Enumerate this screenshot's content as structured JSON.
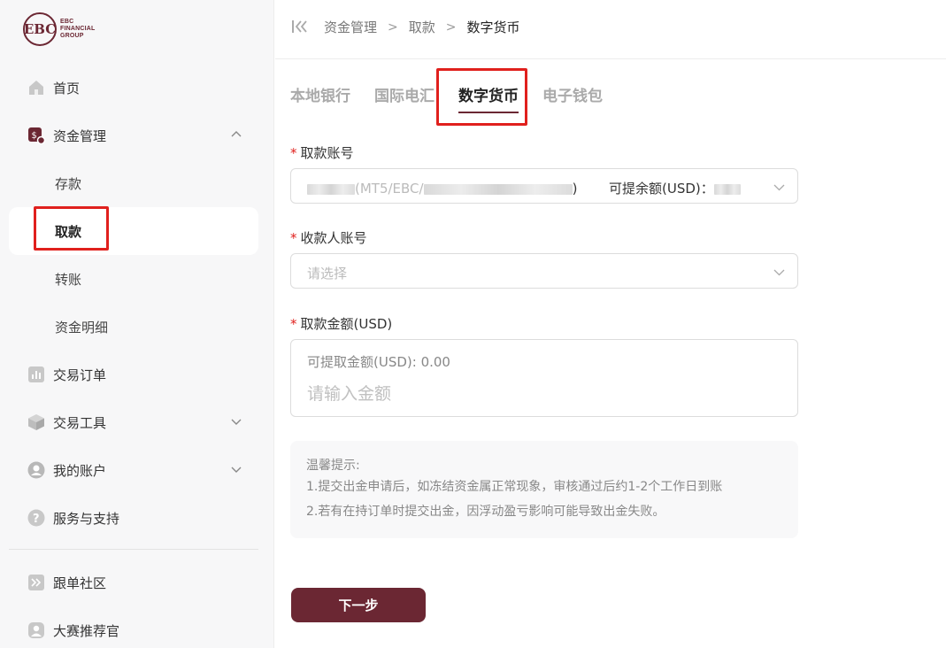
{
  "brand": {
    "logo_letters": "EBC",
    "line1": "EBC",
    "line2": "FINANCIAL",
    "line3": "GROUP",
    "color": "#6b2733"
  },
  "sidebar": {
    "items": [
      {
        "label": "首页",
        "icon": "home-icon"
      },
      {
        "label": "资金管理",
        "icon": "fund-icon",
        "expanded": true
      },
      {
        "label": "交易订单",
        "icon": "chart-icon"
      },
      {
        "label": "交易工具",
        "icon": "cube-icon"
      },
      {
        "label": "我的账户",
        "icon": "user-icon"
      },
      {
        "label": "服务与支持",
        "icon": "help-icon"
      },
      {
        "label": "跟单社区",
        "icon": "copy-trade-icon"
      },
      {
        "label": "大赛推荐官",
        "icon": "referral-icon"
      }
    ],
    "sub_items": [
      {
        "label": "存款"
      },
      {
        "label": "取款",
        "active": true
      },
      {
        "label": "转账"
      },
      {
        "label": "资金明细"
      }
    ]
  },
  "breadcrumb": {
    "items": [
      "资金管理",
      "取款",
      "数字货币"
    ]
  },
  "tabs": [
    {
      "label": "本地银行"
    },
    {
      "label": "国际电汇"
    },
    {
      "label": "数字货币",
      "active": true
    },
    {
      "label": "电子钱包"
    }
  ],
  "form": {
    "account": {
      "label": "取款账号",
      "value_partial": "(MT5/EBC/",
      "value_end": ")",
      "balance_label": "可提余额(USD)："
    },
    "payee": {
      "label": "收款人账号",
      "placeholder": "请选择"
    },
    "amount": {
      "label": "取款金额(USD)",
      "available": "可提取金额(USD): 0.00",
      "placeholder": "请输入金额"
    }
  },
  "tips": {
    "title": "温馨提示:",
    "lines": [
      "1.提交出金申请后，如冻结资金属正常现象，审核通过后约1-2个工作日到账",
      "2.若有在持订单时提交出金，因浮动盈亏影响可能导致出金失败。"
    ]
  },
  "next_button": {
    "label": "下一步"
  },
  "colors": {
    "accent": "#6b2733",
    "highlight": "#e0201d"
  }
}
